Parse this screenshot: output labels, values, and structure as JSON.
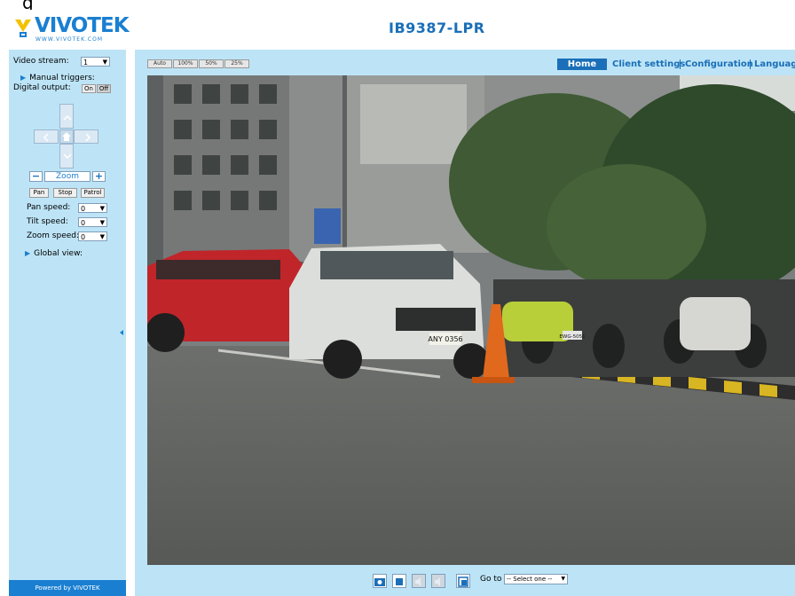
{
  "top_fragment": "g",
  "brand": {
    "name": "VIVOTEK",
    "url_text": "WWW.VIVOTEK.COM"
  },
  "camera_title": "IB9387-LPR",
  "nav": {
    "home": "Home",
    "client_settings": "Client settings",
    "configuration": "Configuration",
    "language": "Language"
  },
  "view_buttons": [
    "Auto",
    "100%",
    "50%",
    "25%"
  ],
  "sidebar": {
    "video_stream_label": "Video stream:",
    "video_stream_value": "1",
    "manual_triggers_label": "Manual triggers:",
    "digital_output_label": "Digital output:",
    "on_label": "On",
    "off_label": "Off",
    "zoom_label": "Zoom",
    "zoom_minus": "−",
    "zoom_plus": "+",
    "pan_button": "Pan",
    "stop_button": "Stop",
    "patrol_button": "Patrol",
    "pan_speed_label": "Pan speed:",
    "pan_speed_value": "0",
    "tilt_speed_label": "Tilt speed:",
    "tilt_speed_value": "0",
    "zoom_speed_label": "Zoom speed:",
    "zoom_speed_value": "0",
    "global_view_label": "Global view:",
    "powered_by": "Powered by VIVOTEK"
  },
  "goto": {
    "label": "Go to",
    "selected": "-- Select one --"
  },
  "video": {
    "plate_text": "ANY 0356",
    "plate_text_2": "EWG-5051"
  },
  "colors": {
    "accent": "#1a6fb8",
    "panel": "#bde4f6",
    "nav_home": "#1a6fb8"
  }
}
